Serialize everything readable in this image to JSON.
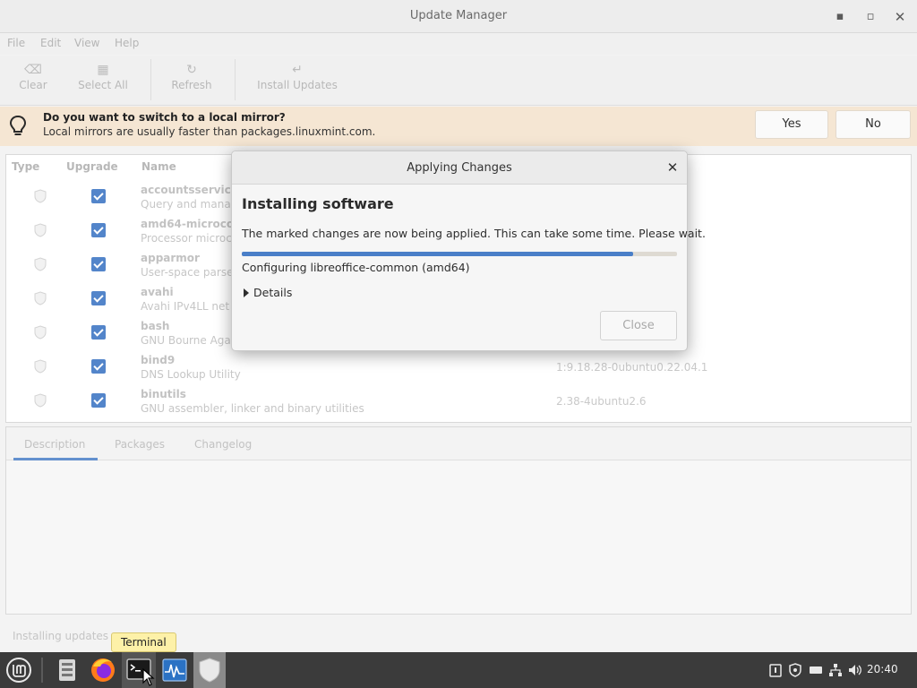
{
  "window": {
    "title": "Update Manager",
    "menu": [
      "File",
      "Edit",
      "View",
      "Help"
    ],
    "toolbar": {
      "clear": "Clear",
      "select_all": "Select All",
      "refresh": "Refresh",
      "install_updates": "Install Updates"
    },
    "infobar": {
      "question": "Do you want to switch to a local mirror?",
      "subtitle": "Local mirrors are usually faster than packages.linuxmint.com.",
      "yes": "Yes",
      "no": "No"
    },
    "columns": {
      "type": "Type",
      "upgrade": "Upgrade",
      "name": "Name"
    },
    "packages": [
      {
        "name": "accountsservice",
        "desc": "Query and manag",
        "version": "",
        "checked": true
      },
      {
        "name": "amd64-microcod",
        "desc": "Processor microc",
        "version": "",
        "checked": true
      },
      {
        "name": "apparmor",
        "desc": "User-space parse",
        "version": "",
        "checked": true
      },
      {
        "name": "avahi",
        "desc": "Avahi IPv4LL net",
        "version": "",
        "checked": true
      },
      {
        "name": "bash",
        "desc": "GNU Bourne Agai",
        "version": "",
        "checked": true
      },
      {
        "name": "bind9",
        "desc": "DNS Lookup Utility",
        "version": "1:9.18.28-0ubuntu0.22.04.1",
        "checked": true
      },
      {
        "name": "binutils",
        "desc": "GNU assembler, linker and binary utilities",
        "version": "2.38-4ubuntu2.6",
        "checked": true
      }
    ],
    "tabs": [
      "Description",
      "Packages",
      "Changelog"
    ],
    "status": "Installing updates"
  },
  "dialog": {
    "title": "Applying Changes",
    "heading": "Installing software",
    "message": "The marked changes are now being applied. This can take some time. Please wait.",
    "progress": 0.9,
    "current_action": "Configuring libreoffice-common (amd64)",
    "details_label": "Details",
    "close_label": "Close"
  },
  "taskbar": {
    "tooltip": "Terminal",
    "clock": "20:40",
    "apps": [
      "menu-icon",
      "files-icon",
      "firefox-icon",
      "terminal-icon",
      "system-monitor-icon",
      "update-manager-icon"
    ]
  },
  "colors": {
    "accent": "#4a7fc8",
    "infobar": "#f5e6d3",
    "taskbar": "#3b3b3b"
  }
}
